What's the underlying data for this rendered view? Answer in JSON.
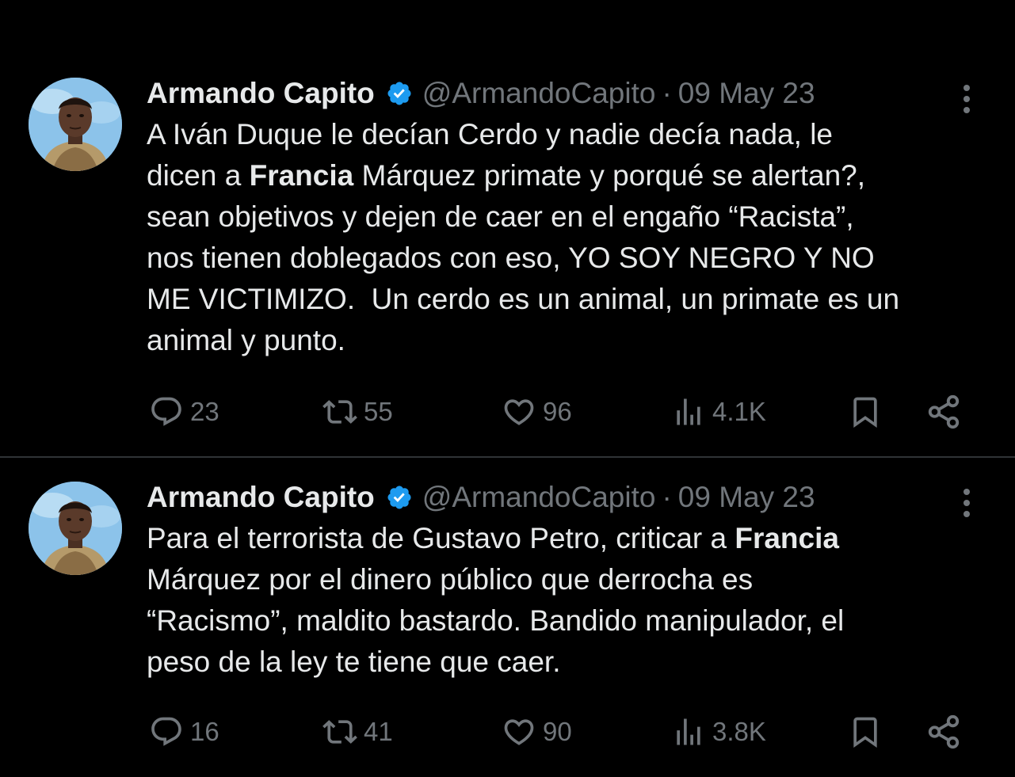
{
  "colors": {
    "background": "#000000",
    "text_primary": "#e7e9ea",
    "text_secondary": "#71767b",
    "verified_badge": "#1d9bf0",
    "divider": "#2f3336"
  },
  "tweets": [
    {
      "author": {
        "display_name": "Armando Capito",
        "handle": "@ArmandoCapito",
        "verified_icon": "verified-badge-icon"
      },
      "separator": "·",
      "date": "09 May 23",
      "text_segments": [
        {
          "text": "A Iván Duque le decían Cerdo y nadie decía nada, le\ndicen a ",
          "bold": false
        },
        {
          "text": "Francia",
          "bold": true
        },
        {
          "text": " Márquez primate y porqué se alertan?,\nsean objetivos y dejen de caer en el engaño “Racista”,\nnos tienen doblegados con eso, YO SOY NEGRO Y NO\nME VICTIMIZO.  Un cerdo es un animal, un primate es un\nanimal y punto.",
          "bold": false
        }
      ],
      "stats": {
        "replies": "23",
        "retweets": "55",
        "likes": "96",
        "views": "4.1K"
      }
    },
    {
      "author": {
        "display_name": "Armando Capito",
        "handle": "@ArmandoCapito",
        "verified_icon": "verified-badge-icon"
      },
      "separator": "·",
      "date": "09 May 23",
      "text_segments": [
        {
          "text": "Para el terrorista de Gustavo Petro, criticar a ",
          "bold": false
        },
        {
          "text": "Francia",
          "bold": true
        },
        {
          "text": "\nMárquez por el dinero público que derrocha es\n“Racismo”, maldito bastardo. Bandido manipulador, el\npeso de la ley te tiene que caer.",
          "bold": false
        }
      ],
      "stats": {
        "replies": "16",
        "retweets": "41",
        "likes": "90",
        "views": "3.8K"
      }
    }
  ]
}
